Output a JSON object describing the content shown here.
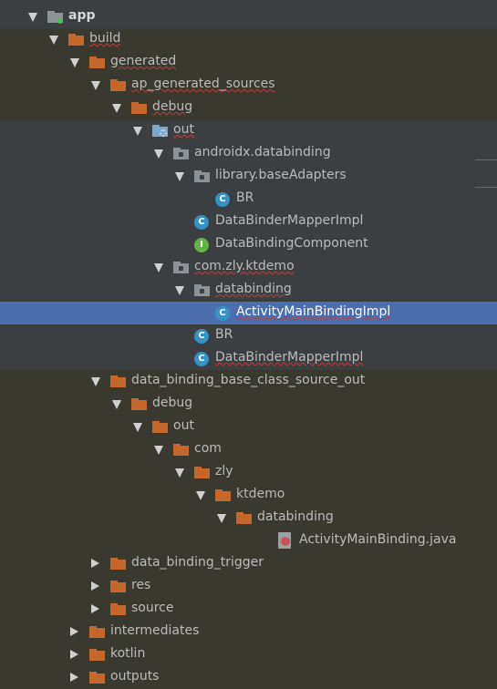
{
  "tree": [
    {
      "label": "app",
      "depth": 0,
      "state": "expanded",
      "icon": "module-folder",
      "bold": true,
      "squig": false,
      "bg": "none"
    },
    {
      "label": "build",
      "depth": 1,
      "state": "expanded",
      "icon": "folder",
      "squig": true,
      "bg": "gen"
    },
    {
      "label": "generated",
      "depth": 2,
      "state": "expanded",
      "icon": "folder",
      "squig": true,
      "bg": "gen"
    },
    {
      "label": "ap_generated_sources",
      "depth": 3,
      "state": "expanded",
      "icon": "folder",
      "squig": true,
      "bg": "gen"
    },
    {
      "label": "debug",
      "depth": 4,
      "state": "expanded",
      "icon": "folder",
      "squig": true,
      "bg": "gen"
    },
    {
      "label": "out",
      "depth": 5,
      "state": "expanded",
      "icon": "out-folder",
      "squig": true,
      "bg": "none"
    },
    {
      "label": "androidx.databinding",
      "depth": 6,
      "state": "expanded",
      "icon": "package",
      "squig": false,
      "bg": "none"
    },
    {
      "label": "library.baseAdapters",
      "depth": 7,
      "state": "expanded",
      "icon": "package",
      "squig": false,
      "bg": "none"
    },
    {
      "label": "BR",
      "depth": 8,
      "state": "leaf",
      "icon": "class",
      "squig": false,
      "bg": "none"
    },
    {
      "label": "DataBinderMapperImpl",
      "depth": 7,
      "state": "leaf",
      "icon": "class",
      "squig": false,
      "bg": "none"
    },
    {
      "label": "DataBindingComponent",
      "depth": 7,
      "state": "leaf",
      "icon": "interface",
      "squig": false,
      "bg": "none"
    },
    {
      "label": "com.zly.ktdemo",
      "depth": 6,
      "state": "expanded",
      "icon": "package",
      "squig": true,
      "bg": "none"
    },
    {
      "label": "databinding",
      "depth": 7,
      "state": "expanded",
      "icon": "package",
      "squig": true,
      "bg": "none"
    },
    {
      "label": "ActivityMainBindingImpl",
      "depth": 8,
      "state": "leaf",
      "icon": "class",
      "squig": true,
      "bg": "selected"
    },
    {
      "label": "BR",
      "depth": 7,
      "state": "leaf",
      "icon": "class",
      "squig": false,
      "bg": "none"
    },
    {
      "label": "DataBinderMapperImpl",
      "depth": 7,
      "state": "leaf",
      "icon": "class",
      "squig": true,
      "bg": "none"
    },
    {
      "label": "data_binding_base_class_source_out",
      "depth": 3,
      "state": "expanded",
      "icon": "folder",
      "squig": false,
      "bg": "gen"
    },
    {
      "label": "debug",
      "depth": 4,
      "state": "expanded",
      "icon": "folder",
      "squig": false,
      "bg": "gen"
    },
    {
      "label": "out",
      "depth": 5,
      "state": "expanded",
      "icon": "folder",
      "squig": false,
      "bg": "gen"
    },
    {
      "label": "com",
      "depth": 6,
      "state": "expanded",
      "icon": "folder",
      "squig": false,
      "bg": "gen"
    },
    {
      "label": "zly",
      "depth": 7,
      "state": "expanded",
      "icon": "folder",
      "squig": false,
      "bg": "gen"
    },
    {
      "label": "ktdemo",
      "depth": 8,
      "state": "expanded",
      "icon": "folder",
      "squig": false,
      "bg": "gen"
    },
    {
      "label": "databinding",
      "depth": 9,
      "state": "expanded",
      "icon": "folder",
      "squig": false,
      "bg": "gen"
    },
    {
      "label": "ActivityMainBinding.java",
      "depth": 11,
      "state": "leaf",
      "icon": "java-file",
      "squig": false,
      "bg": "gen"
    },
    {
      "label": "data_binding_trigger",
      "depth": 3,
      "state": "collapsed",
      "icon": "folder",
      "squig": false,
      "bg": "gen"
    },
    {
      "label": "res",
      "depth": 3,
      "state": "collapsed",
      "icon": "folder",
      "squig": false,
      "bg": "gen"
    },
    {
      "label": "source",
      "depth": 3,
      "state": "collapsed",
      "icon": "folder",
      "squig": false,
      "bg": "gen"
    },
    {
      "label": "intermediates",
      "depth": 2,
      "state": "collapsed",
      "icon": "folder",
      "squig": false,
      "bg": "gen"
    },
    {
      "label": "kotlin",
      "depth": 2,
      "state": "collapsed",
      "icon": "folder",
      "squig": false,
      "bg": "gen"
    },
    {
      "label": "outputs",
      "depth": 2,
      "state": "collapsed",
      "icon": "folder",
      "squig": false,
      "bg": "gen"
    }
  ],
  "class_glyph": "C",
  "interface_glyph": "I"
}
